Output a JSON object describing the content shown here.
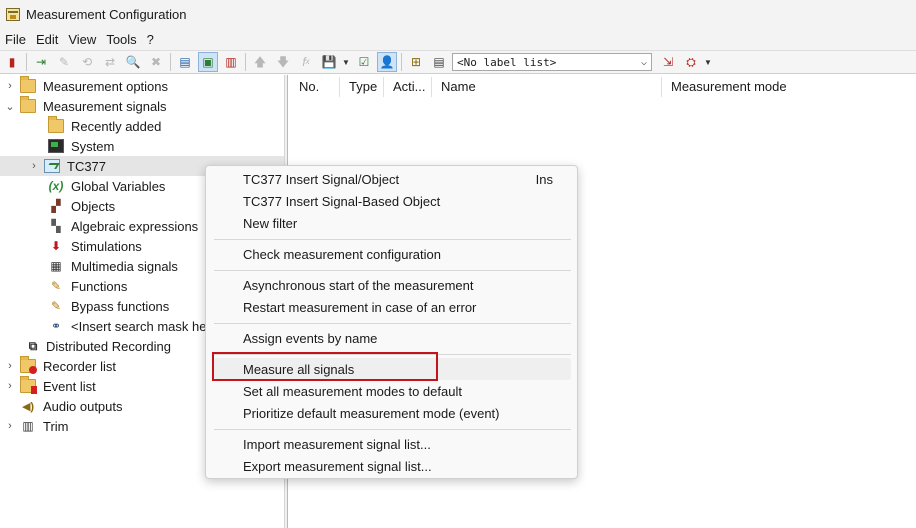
{
  "window": {
    "title": "Measurement Configuration"
  },
  "menubar": {
    "items": [
      "File",
      "Edit",
      "View",
      "Tools",
      "?"
    ]
  },
  "toolbar": {
    "label_list_value": "<No label list>"
  },
  "tree": {
    "items": [
      {
        "label": "Measurement options",
        "icon": "folder-icon",
        "expander": ">"
      },
      {
        "label": "Measurement signals",
        "icon": "folder-open-icon",
        "expander": "v"
      },
      {
        "label": "Recently added",
        "icon": "folder-icon",
        "expander": ""
      },
      {
        "label": "System",
        "icon": "system-icon",
        "expander": ""
      },
      {
        "label": "TC377",
        "icon": "tc377-device-icon",
        "expander": ">"
      },
      {
        "label": "Global Variables",
        "icon": "variables-icon",
        "expander": "",
        "glyph": "(x)"
      },
      {
        "label": "Objects",
        "icon": "objects-icon",
        "expander": "",
        "glyph": "▞"
      },
      {
        "label": "Algebraic expressions",
        "icon": "algebraic-icon",
        "expander": "",
        "glyph": "▚"
      },
      {
        "label": "Stimulations",
        "icon": "stimulation-icon",
        "expander": "",
        "glyph": "⬇"
      },
      {
        "label": "Multimedia signals",
        "icon": "multimedia-icon",
        "expander": "",
        "glyph": "▦"
      },
      {
        "label": "Functions",
        "icon": "functions-icon",
        "expander": "",
        "glyph": "✎"
      },
      {
        "label": "Bypass functions",
        "icon": "bypass-icon",
        "expander": "",
        "glyph": "✎"
      },
      {
        "label": "<Insert search mask he",
        "icon": "binoculars-icon",
        "expander": "",
        "glyph": "⚭"
      },
      {
        "label": "Distributed Recording",
        "icon": "distributed-icon",
        "expander": "",
        "glyph": "⧉"
      },
      {
        "label": "Recorder list",
        "icon": "recorder-icon",
        "expander": ">"
      },
      {
        "label": "Event list",
        "icon": "event-icon",
        "expander": ">"
      },
      {
        "label": "Audio outputs",
        "icon": "speaker-icon",
        "expander": "",
        "glyph": "🔊"
      },
      {
        "label": "Trim",
        "icon": "trim-icon",
        "expander": ">",
        "glyph": "▥"
      }
    ]
  },
  "list": {
    "columns": [
      "No.",
      "Type",
      "Acti...",
      "Name",
      "Measurement mode"
    ]
  },
  "context_menu": {
    "items": [
      {
        "label": "TC377 Insert Signal/Object",
        "shortcut": "Ins"
      },
      {
        "label": "TC377 Insert Signal-Based Object"
      },
      {
        "label": "New filter"
      },
      {
        "label": "Check measurement configuration"
      },
      {
        "label": "Asynchronous start of the measurement"
      },
      {
        "label": "Restart measurement in case of an error"
      },
      {
        "label": "Assign events by name"
      },
      {
        "label": "Measure all signals"
      },
      {
        "label": "Set all measurement modes to default"
      },
      {
        "label": "Prioritize default measurement mode (event)"
      },
      {
        "label": "Import measurement signal list..."
      },
      {
        "label": "Export measurement signal list..."
      }
    ]
  },
  "colors": {
    "highlight": "#c1141b",
    "selection": "#e5e5e5"
  }
}
